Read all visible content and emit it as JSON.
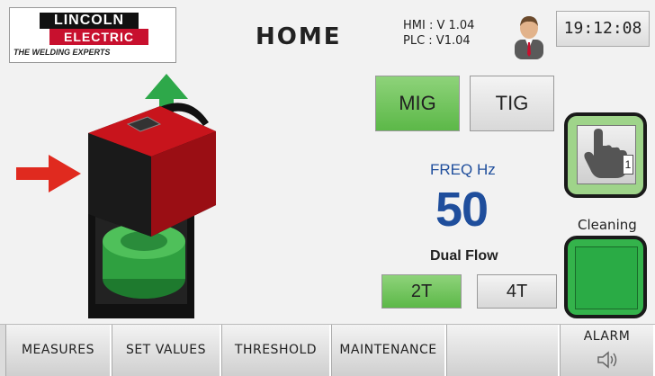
{
  "header": {
    "logo": {
      "line1": "LINCOLN",
      "line2": "ELECTRIC",
      "tagline": "THE WELDING EXPERTS"
    },
    "title": "HOME",
    "hmi_version": "HMI : V 1.04",
    "plc_version": "PLC : V1.04",
    "time": "19:12:08"
  },
  "controls": {
    "mig_label": "MIG",
    "tig_label": "TIG",
    "selected_process": "MIG",
    "freq_label": "FREQ Hz",
    "freq_value": "50",
    "dual_flow_label": "Dual Flow",
    "t2_label": "2T",
    "t4_label": "4T",
    "selected_trigger": "2T",
    "hand_badge": "1",
    "cleaning_label": "Cleaning"
  },
  "bottom_tabs": [
    "MEASURES",
    "SET VALUES",
    "THRESHOLD",
    "MAINTENANCE",
    ""
  ],
  "alarm_label": "ALARM",
  "colors": {
    "active_green": "#5cb848",
    "cleaning_green": "#34b34b",
    "freq_blue": "#1f4e9c",
    "machine_red": "#b01016",
    "arrow_red": "#e02a1f",
    "arrow_green": "#2ea84a"
  }
}
